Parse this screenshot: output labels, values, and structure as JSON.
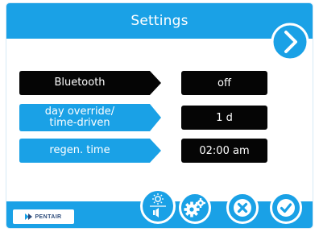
{
  "header": {
    "title": "Settings",
    "next_icon": "chevron-right-icon"
  },
  "settings": [
    {
      "label_lines": [
        "Bluetooth"
      ],
      "value": "off",
      "style": "black"
    },
    {
      "label_lines": [
        "day override/",
        "time-driven"
      ],
      "value": "1 d",
      "style": "blue"
    },
    {
      "label_lines": [
        "regen. time"
      ],
      "value": "02:00 am",
      "style": "blue"
    }
  ],
  "footer": {
    "logo_text": "PENTAIR",
    "buttons": [
      {
        "name": "brightness-volume",
        "icons": [
          "sun-icon",
          "speaker-icon"
        ]
      },
      {
        "name": "advanced-settings",
        "icons": [
          "gears-icon"
        ]
      },
      {
        "name": "cancel",
        "icons": [
          "close-icon"
        ]
      },
      {
        "name": "confirm",
        "icons": [
          "checkmark-icon"
        ]
      }
    ]
  },
  "colors": {
    "primary_blue": "#1aa1e6",
    "black": "#050505",
    "white": "#ffffff"
  }
}
